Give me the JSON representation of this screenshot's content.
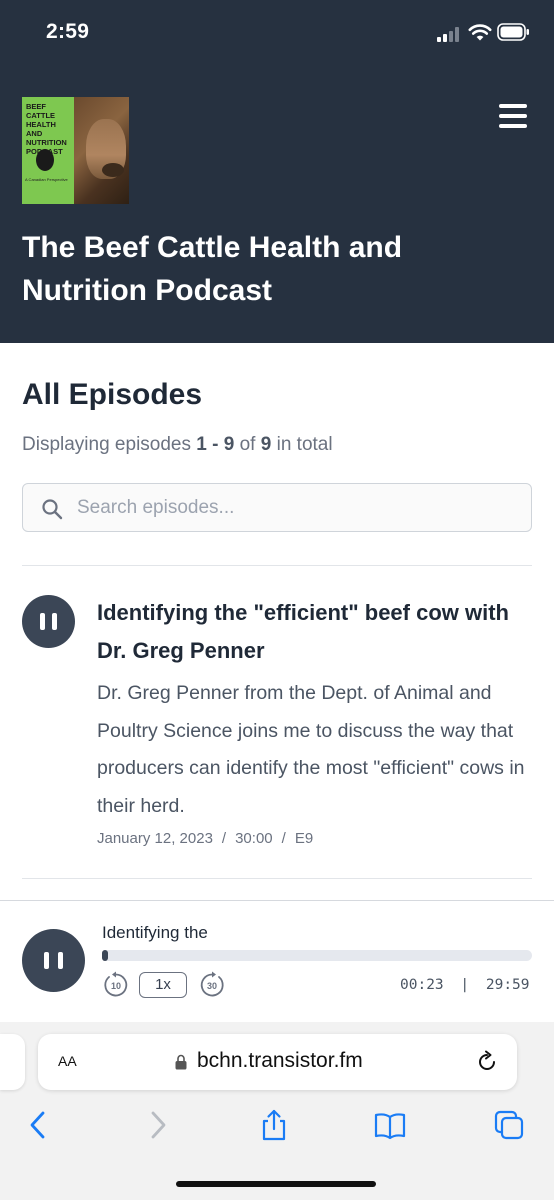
{
  "status_bar": {
    "time": "2:59"
  },
  "header": {
    "cover_art": {
      "text": "BEEF CATTLE HEALTH AND NUTRITION PODCAST",
      "subtext": "A Canadian Perspective"
    },
    "menu_icon": "hamburger-menu-icon",
    "title": "The Beef Cattle Health and Nutrition Podcast"
  },
  "episodes_section": {
    "title": "All Episodes",
    "displaying_prefix": "Displaying episodes",
    "range_start": "1",
    "range_dash": " - ",
    "range_end": "9",
    "of_label": "of",
    "total": "9",
    "total_suffix": "in total",
    "search_placeholder": "Search episodes..."
  },
  "episodes": [
    {
      "title": "Identifying the \"efficient\" beef cow with Dr. Greg Penner",
      "description": "Dr. Greg Penner from the Dept. of Animal and Poultry Science joins me to discuss the way that producers can identify the most \"efficient\" cows in their herd.",
      "date": "January 12, 2023",
      "duration": "30:00",
      "episode_number": "E9",
      "state": "playing"
    }
  ],
  "player": {
    "title": "Identifying the",
    "progress_fraction": 0.013,
    "rewind_label": "10",
    "speed_label": "1x",
    "forward_label": "30",
    "elapsed": "00:23",
    "separator": "|",
    "total": "29:59"
  },
  "browser": {
    "text_size_label": "AA",
    "url": "bchn.transistor.fm"
  },
  "colors": {
    "header_bg": "#263140",
    "accent": "#3b4656",
    "ios_blue": "#1a7cf5"
  }
}
